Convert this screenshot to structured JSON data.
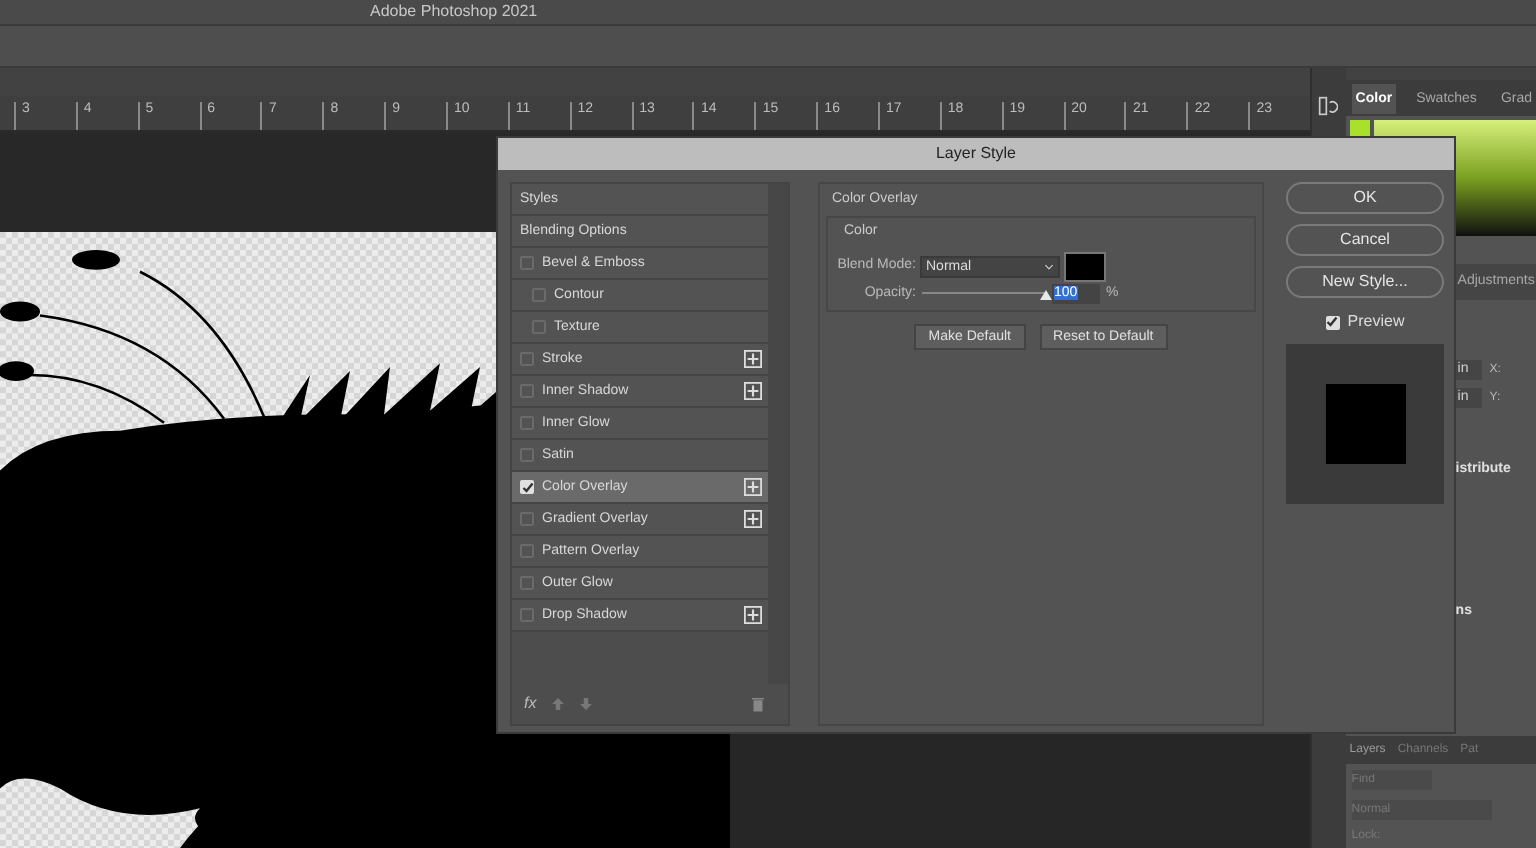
{
  "app_title": "Adobe Photoshop 2021",
  "ruler": [
    "3",
    "4",
    "5",
    "6",
    "7",
    "8",
    "9",
    "10",
    "11",
    "12",
    "13",
    "14",
    "15",
    "16",
    "17",
    "18",
    "19",
    "20",
    "21",
    "22",
    "23"
  ],
  "color_panel": {
    "tabs": [
      {
        "label": "Color",
        "selected": true
      },
      {
        "label": "Swatches",
        "selected": false
      },
      {
        "label": "Grad",
        "selected": false
      }
    ]
  },
  "properties_panel": {
    "tab": "Adjustments",
    "fields": [
      {
        "value": "in",
        "label": "X:"
      },
      {
        "value": "in",
        "label": "Y:"
      }
    ],
    "section_1": "istribute",
    "section_2": "ns"
  },
  "layers_panel": {
    "tabs": [
      {
        "label": "Layers",
        "selected": true
      },
      {
        "label": "Channels",
        "selected": false
      },
      {
        "label": "Pat",
        "selected": false
      }
    ],
    "search_placeholder": "Find",
    "blend_mode": "Normal",
    "lock_label": "Lock:"
  },
  "dialog": {
    "title": "Layer Style",
    "styles": [
      {
        "label": "Styles",
        "kind": "header",
        "selected": false
      },
      {
        "label": "Blending Options",
        "kind": "header",
        "selected": false
      },
      {
        "label": "Bevel & Emboss",
        "kind": "effect",
        "checked": false,
        "addable": false,
        "selected": false
      },
      {
        "label": "Contour",
        "kind": "sub",
        "checked": false,
        "selected": false
      },
      {
        "label": "Texture",
        "kind": "sub",
        "checked": false,
        "selected": false
      },
      {
        "label": "Stroke",
        "kind": "effect",
        "checked": false,
        "addable": true,
        "selected": false
      },
      {
        "label": "Inner Shadow",
        "kind": "effect",
        "checked": false,
        "addable": true,
        "selected": false
      },
      {
        "label": "Inner Glow",
        "kind": "effect",
        "checked": false,
        "addable": false,
        "selected": false
      },
      {
        "label": "Satin",
        "kind": "effect",
        "checked": false,
        "addable": false,
        "selected": false
      },
      {
        "label": "Color Overlay",
        "kind": "effect",
        "checked": true,
        "addable": true,
        "selected": true
      },
      {
        "label": "Gradient Overlay",
        "kind": "effect",
        "checked": false,
        "addable": true,
        "selected": false
      },
      {
        "label": "Pattern Overlay",
        "kind": "effect",
        "checked": false,
        "addable": false,
        "selected": false
      },
      {
        "label": "Outer Glow",
        "kind": "effect",
        "checked": false,
        "addable": false,
        "selected": false
      },
      {
        "label": "Drop Shadow",
        "kind": "effect",
        "checked": false,
        "addable": true,
        "selected": false
      }
    ],
    "fx_label": "fx",
    "settings": {
      "group": "Color Overlay",
      "subgroup": "Color",
      "blend_label": "Blend Mode:",
      "blend_value": "Normal",
      "color": "#000000",
      "opacity_label": "Opacity:",
      "opacity": {
        "level": 1,
        "value": "100",
        "unit": "%"
      },
      "buttons": [
        "Make Default",
        "Reset to Default"
      ]
    },
    "actions": [
      "OK",
      "Cancel",
      "New Style..."
    ],
    "preview": {
      "label": "Preview",
      "checked": true
    }
  }
}
